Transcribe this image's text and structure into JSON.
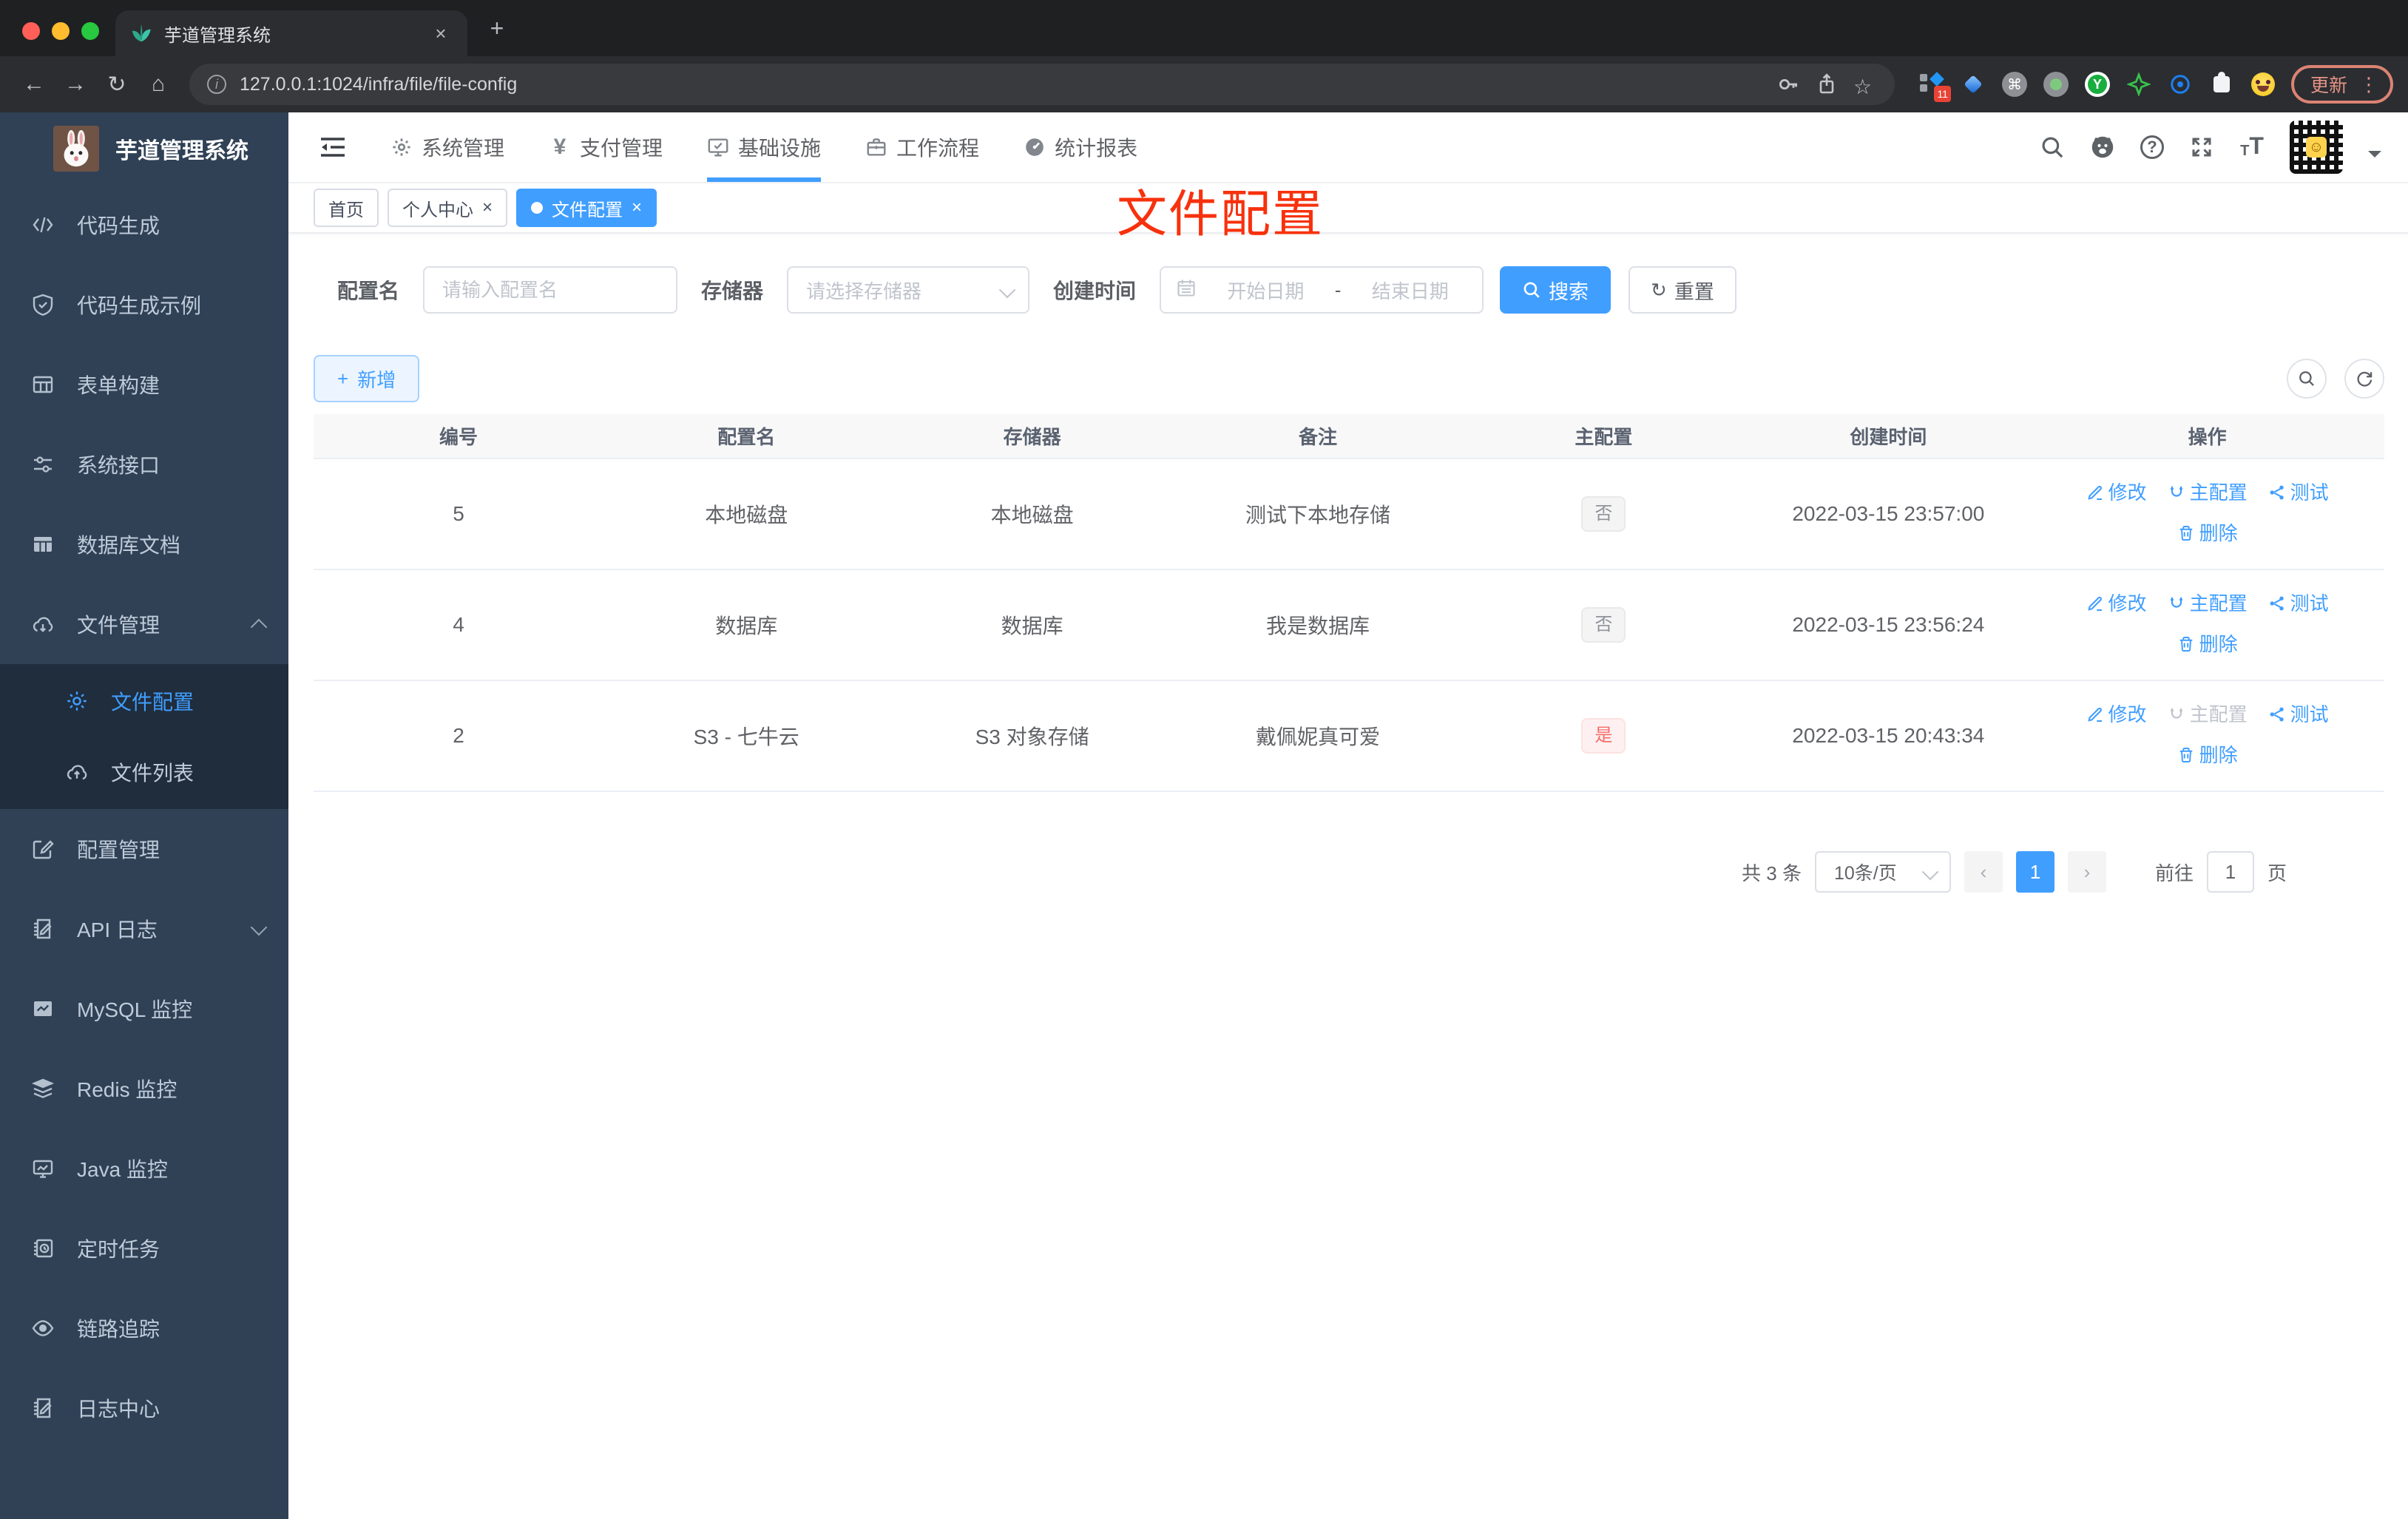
{
  "colors": {
    "accent": "#409eff",
    "danger": "#f56c6c",
    "annotation_red": "#f7310d",
    "sidebar_bg": "#304156",
    "submenu_bg": "#1f2d3d"
  },
  "browser": {
    "tab_title": "芋道管理系统",
    "url": "127.0.0.1:1024/infra/file/file-config",
    "ext_badge": "11",
    "update_label": "更新"
  },
  "sidebar": {
    "logo_title": "芋道管理系统",
    "items": [
      {
        "label": "代码生成",
        "icon": "code-icon"
      },
      {
        "label": "代码生成示例",
        "icon": "shield-check-icon"
      },
      {
        "label": "表单构建",
        "icon": "form-grid-icon"
      },
      {
        "label": "系统接口",
        "icon": "sliders-icon"
      },
      {
        "label": "数据库文档",
        "icon": "database-table-icon"
      },
      {
        "label": "文件管理",
        "icon": "cloud-download-icon"
      },
      {
        "label": "文件配置",
        "icon": "gear-icon"
      },
      {
        "label": "文件列表",
        "icon": "cloud-upload-icon"
      },
      {
        "label": "配置管理",
        "icon": "edit-square-icon"
      },
      {
        "label": "API 日志",
        "icon": "log-edit-icon"
      },
      {
        "label": "MySQL 监控",
        "icon": "chart-icon"
      },
      {
        "label": "Redis 监控",
        "icon": "layers-icon"
      },
      {
        "label": "Java 监控",
        "icon": "monitor-icon"
      },
      {
        "label": "定时任务",
        "icon": "schedule-icon"
      },
      {
        "label": "链路追踪",
        "icon": "eye-icon"
      },
      {
        "label": "日志中心",
        "icon": "log-center-icon"
      }
    ]
  },
  "topnav": {
    "items": [
      {
        "label": "系统管理",
        "icon": "gear-icon"
      },
      {
        "label": "支付管理",
        "icon": "yen-icon"
      },
      {
        "label": "基础设施",
        "icon": "infra-monitor-icon"
      },
      {
        "label": "工作流程",
        "icon": "briefcase-icon"
      },
      {
        "label": "统计报表",
        "icon": "gauge-icon"
      }
    ]
  },
  "tabs": [
    {
      "label": "首页"
    },
    {
      "label": "个人中心"
    },
    {
      "label": "文件配置"
    }
  ],
  "annotation": {
    "text": "文件配置"
  },
  "filter": {
    "name_label": "配置名",
    "name_placeholder": "请输入配置名",
    "storage_label": "存储器",
    "storage_placeholder": "请选择存储器",
    "time_label": "创建时间",
    "start_placeholder": "开始日期",
    "separator": "-",
    "end_placeholder": "结束日期",
    "search_label": "搜索",
    "reset_label": "重置"
  },
  "toolbar": {
    "add_label": "新增"
  },
  "table": {
    "headers": [
      "编号",
      "配置名",
      "存储器",
      "备注",
      "主配置",
      "创建时间",
      "操作"
    ],
    "actions": {
      "edit": "修改",
      "master": "主配置",
      "test": "测试",
      "delete": "删除"
    },
    "rows": [
      {
        "id": "5",
        "name": "本地磁盘",
        "storage": "本地磁盘",
        "remark": "测试下本地存储",
        "master": "否",
        "time": "2022-03-15 23:57:00"
      },
      {
        "id": "4",
        "name": "数据库",
        "storage": "数据库",
        "remark": "我是数据库",
        "master": "否",
        "time": "2022-03-15 23:56:24"
      },
      {
        "id": "2",
        "name": "S3 - 七牛云",
        "storage": "S3 对象存储",
        "remark": "戴佩妮真可爱",
        "master": "是",
        "time": "2022-03-15 20:43:34"
      }
    ]
  },
  "pagination": {
    "total": "共 3 条",
    "page_size": "10条/页",
    "page": "1",
    "goto_label": "前往",
    "goto_value": "1",
    "unit": "页"
  }
}
